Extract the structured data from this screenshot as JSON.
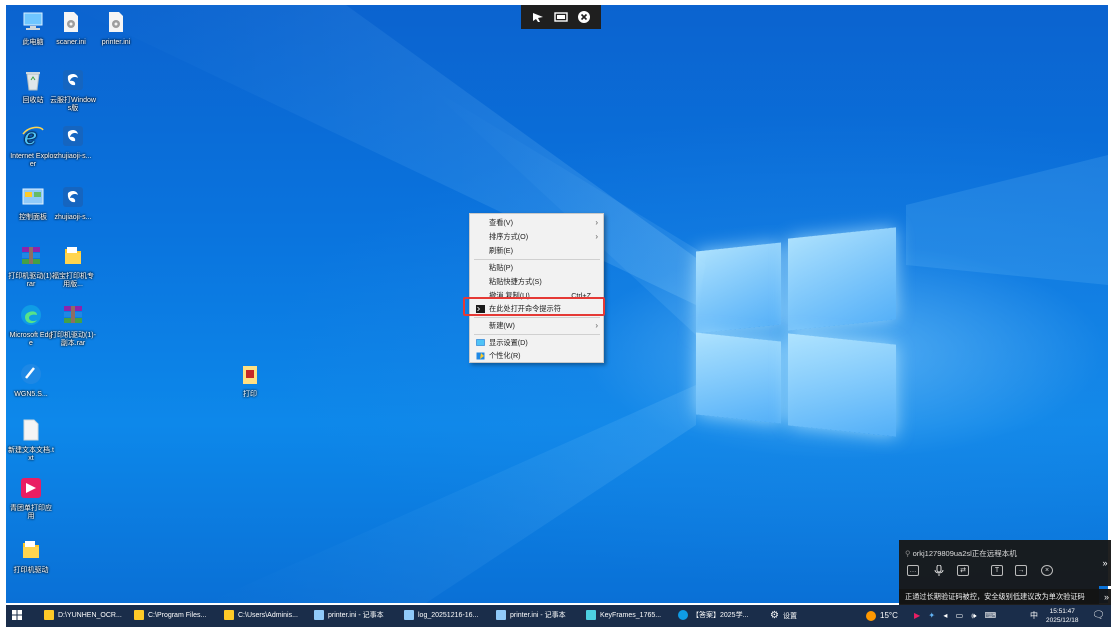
{
  "remote_bar": {
    "icons": [
      "cursor-icon",
      "screen-icon",
      "close-icon"
    ]
  },
  "desktop_icons": [
    {
      "id": "computer",
      "label": "此电脑",
      "icon": "computer-icon"
    },
    {
      "id": "scanerini",
      "label": "scaner.ini",
      "icon": "settings-file-icon"
    },
    {
      "id": "printerini",
      "label": "printer.ini",
      "icon": "settings-file-icon"
    },
    {
      "id": "recycle",
      "label": "回收站",
      "icon": "recycle-bin-icon"
    },
    {
      "id": "app1",
      "label": "云服打Windows版",
      "icon": "app-icon"
    },
    {
      "id": "ie",
      "label": "Internet Explorer",
      "icon": "ie-icon"
    },
    {
      "id": "app2",
      "label": "zhujiaoji-s...",
      "icon": "app-icon"
    },
    {
      "id": "control",
      "label": "控制面板",
      "icon": "control-panel-icon"
    },
    {
      "id": "app3",
      "label": "zhujiaoji-s...",
      "icon": "app-icon"
    },
    {
      "id": "rar1",
      "label": "打印机驱动(1).rar",
      "icon": "winrar-icon"
    },
    {
      "id": "folder1",
      "label": "福宝打印机专用版...",
      "icon": "folder-icon"
    },
    {
      "id": "edge",
      "label": "Microsoft Edge",
      "icon": "edge-icon"
    },
    {
      "id": "rar2",
      "label": "打印机驱动(1)-副本.rar",
      "icon": "winrar-icon"
    },
    {
      "id": "wgn",
      "label": "WGN5.S...",
      "icon": "wps-icon"
    },
    {
      "id": "txt",
      "label": "新建文本文档.txt",
      "icon": "text-file-icon"
    },
    {
      "id": "app4",
      "label": "青团单打印应用",
      "icon": "pinkapp-icon"
    },
    {
      "id": "folder2",
      "label": "打印机驱动",
      "icon": "folder-icon"
    },
    {
      "id": "print",
      "label": "打印",
      "icon": "print-icon"
    }
  ],
  "context_menu": {
    "items": [
      {
        "label": "查看(V)",
        "submenu": true
      },
      {
        "label": "排序方式(O)",
        "submenu": true
      },
      {
        "label": "刷新(E)"
      },
      {
        "label": "粘贴(P)"
      },
      {
        "label": "粘贴快捷方式(S)"
      },
      {
        "label": "撤消 复制(U)",
        "accel": "Ctrl+Z"
      },
      {
        "label": "在此处打开命令提示符",
        "icon": "cmd-icon",
        "highlighted": true
      },
      {
        "label": "新建(W)",
        "submenu": true
      },
      {
        "label": "显示设置(D)",
        "icon": "display-icon"
      },
      {
        "label": "个性化(R)",
        "icon": "personalize-icon"
      }
    ]
  },
  "notification": {
    "message": "orkj1279809ua2sl正在远程本机",
    "bottom_text": "正通过长期验证码被控，安全级别低建议改为单次验证码",
    "buttons": [
      "chat-icon",
      "mic-icon",
      "transfer-icon",
      "text-icon",
      "file-icon",
      "close-icon"
    ]
  },
  "taskbar": {
    "items": [
      {
        "label": "D:\\YUNHEN_OCR...",
        "icon": "folder"
      },
      {
        "label": "C:\\Program Files...",
        "icon": "folder"
      },
      {
        "label": "C:\\Users\\Adminis...",
        "icon": "folder"
      },
      {
        "label": "printer.ini - 记事本",
        "icon": "notepad"
      },
      {
        "label": "log_20251216-16...",
        "icon": "notepad"
      },
      {
        "label": "printer.ini - 记事本",
        "icon": "notepad"
      },
      {
        "label": "KeyFrames_1765...",
        "icon": "image"
      },
      {
        "label": "【答案】2025学...",
        "icon": "edge"
      },
      {
        "label": "设置",
        "icon": "gear"
      }
    ],
    "weather": "15°C",
    "ime": "中",
    "time": "15:51:47",
    "date": "2025/12/18"
  },
  "colors": {
    "desktop": "#0a74de",
    "taskbar": "#1a2d4a",
    "highlight_border": "#e53935"
  }
}
